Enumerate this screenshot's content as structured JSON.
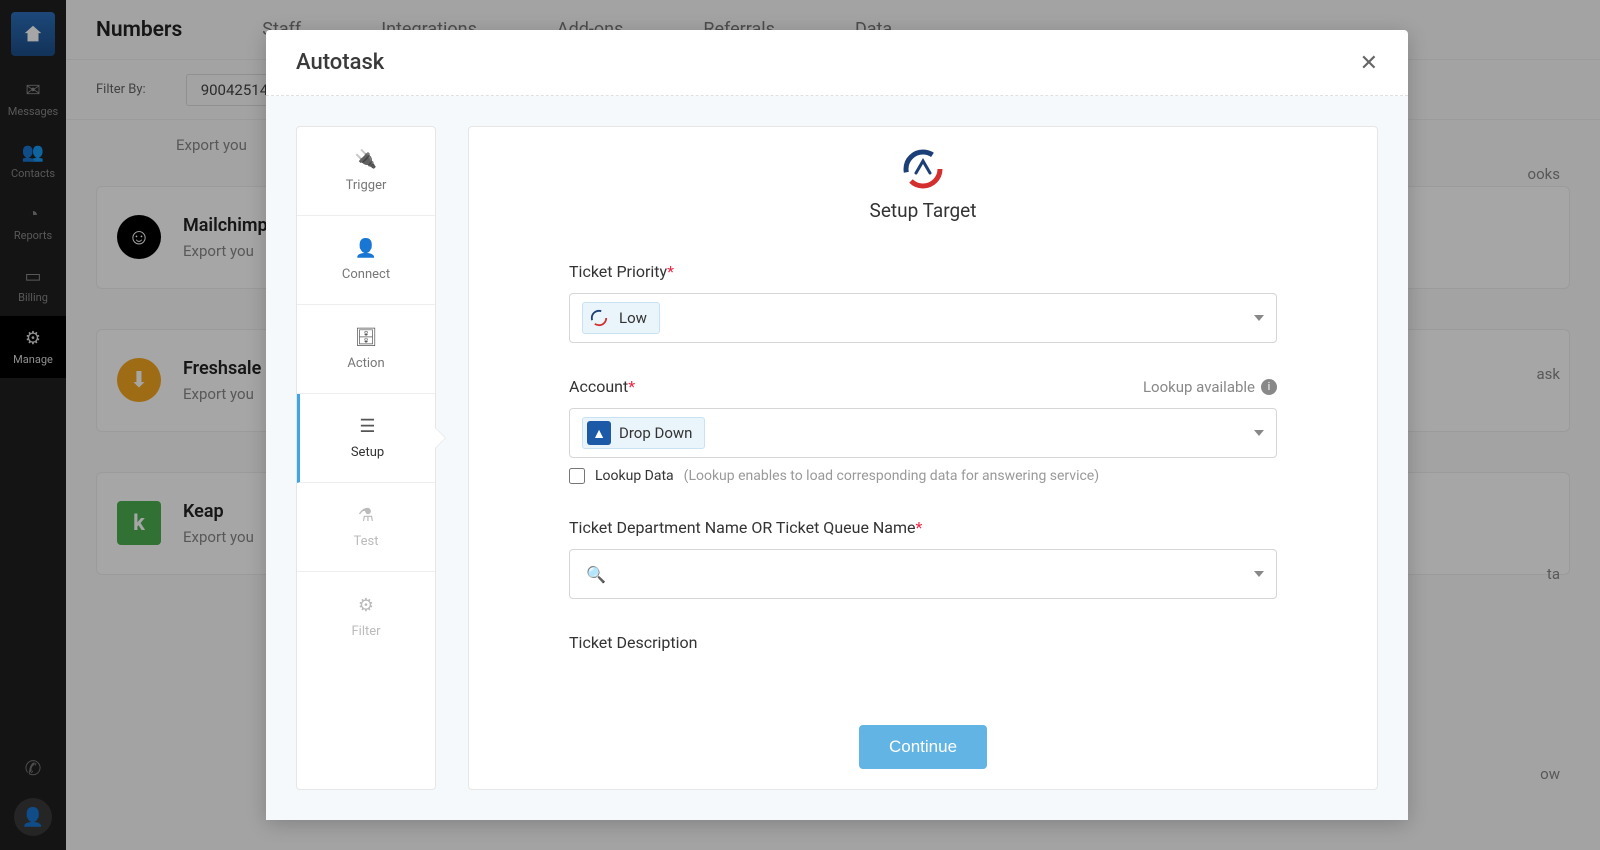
{
  "sidebar": {
    "items": [
      {
        "label": "Messages",
        "icon": "✉"
      },
      {
        "label": "Contacts",
        "icon": "👥"
      },
      {
        "label": "Reports",
        "icon": "◔"
      },
      {
        "label": "Billing",
        "icon": "▭"
      },
      {
        "label": "Manage",
        "icon": "⚙"
      }
    ]
  },
  "topbar": {
    "title": "Numbers",
    "tabs": [
      "Staff",
      "Integrations",
      "Add-ons",
      "Referrals",
      "Data"
    ]
  },
  "filterbar": {
    "label": "Filter By:",
    "value": "90042514"
  },
  "page": {
    "export_text": "Export you",
    "right_words": [
      "ooks",
      "ask",
      "ta",
      "ow"
    ],
    "cards": [
      {
        "title": "Mailchimp",
        "sub": "Export you"
      },
      {
        "title": "Freshsale",
        "sub": "Export you"
      },
      {
        "title": "Keap",
        "sub": "Export you"
      }
    ]
  },
  "modal": {
    "title": "Autotask",
    "steps": [
      {
        "label": "Trigger"
      },
      {
        "label": "Connect"
      },
      {
        "label": "Action"
      },
      {
        "label": "Setup"
      },
      {
        "label": "Test"
      },
      {
        "label": "Filter"
      }
    ],
    "content": {
      "heading": "Setup Target",
      "fields": {
        "priority": {
          "label": "Ticket Priority",
          "required": true,
          "value": "Low"
        },
        "account": {
          "label": "Account",
          "required": true,
          "value": "Drop Down",
          "lookup_hint": "Lookup available",
          "lookup_checkbox_label": "Lookup Data",
          "lookup_checkbox_hint": "(Lookup enables to load corresponding data for answering service)"
        },
        "dept": {
          "label": "Ticket Department Name OR Ticket Queue Name",
          "required": true
        },
        "desc": {
          "label": "Ticket Description",
          "required": false
        }
      },
      "continue_label": "Continue"
    }
  }
}
